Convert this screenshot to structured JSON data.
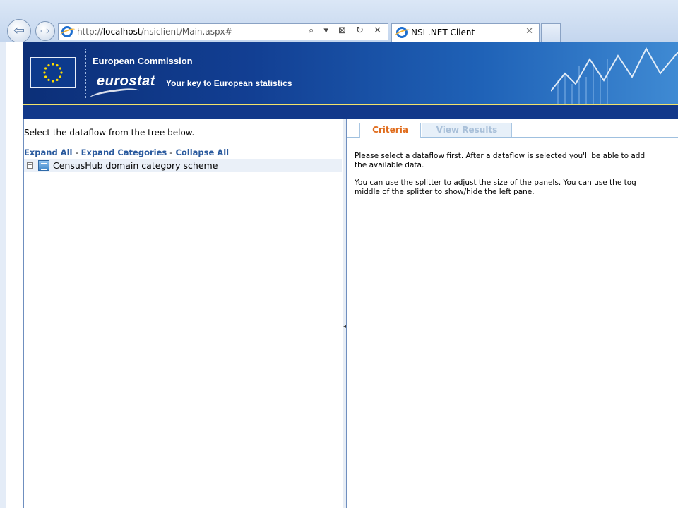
{
  "browser": {
    "url_prefix": "http://",
    "url_host": "localhost",
    "url_path": "/nsiclient/Main.aspx#",
    "address_tools": "⌕ ▾ ⊠ ↻ ✕",
    "tab_title": "NSI .NET Client",
    "tab_close": "✕",
    "back": "⇦",
    "forward": "⇨"
  },
  "header": {
    "organization": "European Commission",
    "brand": "eurostat",
    "tagline": "Your key to European statistics"
  },
  "left_pane": {
    "instruction": "Select the dataflow from the tree below.",
    "expand_all": "Expand All",
    "expand_categories": "Expand Categories",
    "collapse_all": "Collapse All",
    "separator": "-",
    "tree": [
      {
        "label": "CensusHub domain category scheme",
        "expander": "+"
      }
    ]
  },
  "splitter": {
    "handle": "◂"
  },
  "right_pane": {
    "tabs": [
      "Criteria",
      "View Results"
    ],
    "active_tab": "Criteria",
    "message_lines": [
      "Please select a dataflow first. After a dataflow is selected you'll be able to add",
      "the available data.",
      "You can use the splitter to adjust the size of the panels. You can use the tog",
      "middle of the splitter to show/hide the left pane."
    ]
  },
  "colors": {
    "banner_dark": "#0c2f78",
    "banner_light": "#3f8ad3",
    "active_tab": "#e06c1c",
    "link": "#2a5a9e"
  }
}
